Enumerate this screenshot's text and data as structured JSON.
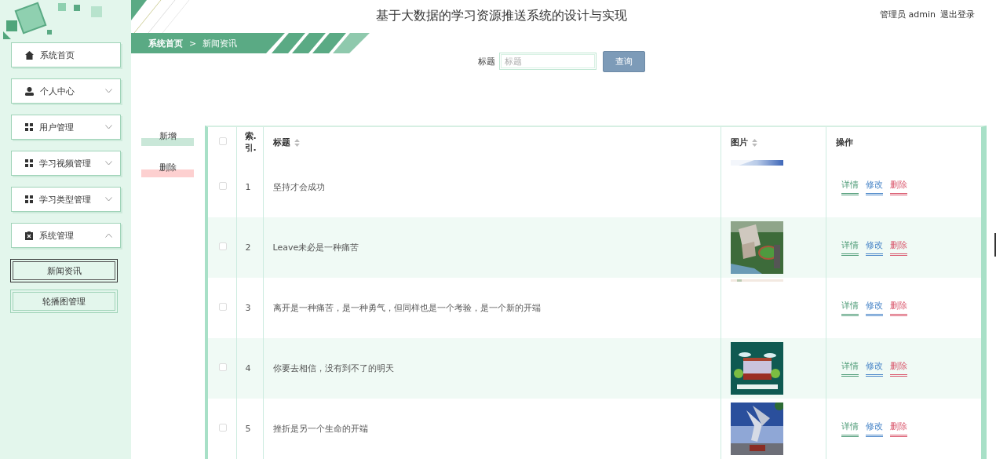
{
  "header": {
    "title": "基于大数据的学习资源推送系统的设计与实现",
    "user_role": "管理员",
    "user_name": "admin",
    "logout": "退出登录"
  },
  "sidebar": {
    "items": [
      {
        "label": "系统首页",
        "kind": "link"
      },
      {
        "label": "个人中心",
        "kind": "group",
        "expanded": false
      },
      {
        "label": "用户管理",
        "kind": "group",
        "expanded": false
      },
      {
        "label": "学习视频管理",
        "kind": "group",
        "expanded": false
      },
      {
        "label": "学习类型管理",
        "kind": "group",
        "expanded": false
      },
      {
        "label": "系统管理",
        "kind": "group",
        "expanded": true,
        "children": [
          {
            "label": "新闻资讯",
            "selected": true
          },
          {
            "label": "轮播图管理",
            "selected": false
          }
        ]
      }
    ]
  },
  "breadcrumb": [
    "系统首页",
    "新闻资讯"
  ],
  "breadcrumb_separator": ">",
  "search": {
    "label": "标题",
    "placeholder": "标题",
    "button": "查询"
  },
  "actions": [
    "新增",
    "删除"
  ],
  "table": {
    "select_all": {
      "checked": false
    },
    "columns": [
      {
        "label": "索.引."
      },
      {
        "label": "标题",
        "sortable": true
      },
      {
        "label": "图片",
        "sortable": true
      },
      {
        "label": "操作"
      }
    ],
    "rows": [
      {
        "selected": false,
        "index": "1",
        "title": "坚持才会成功",
        "actions": [
          {
            "label": "详情",
            "kind": "detail"
          },
          {
            "label": "修改",
            "kind": "edit"
          },
          {
            "label": "删除",
            "kind": "delete"
          }
        ]
      },
      {
        "selected": false,
        "index": "2",
        "title": "Leave未必是一种痛苦",
        "actions": [
          {
            "label": "详情",
            "kind": "detail"
          },
          {
            "label": "修改",
            "kind": "edit"
          },
          {
            "label": "删除",
            "kind": "delete"
          }
        ]
      },
      {
        "selected": false,
        "index": "3",
        "title": "离开是一种痛苦，是一种勇气，但同样也是一个考验，是一个新的开端",
        "actions": [
          {
            "label": "详情",
            "kind": "detail"
          },
          {
            "label": "修改",
            "kind": "edit"
          },
          {
            "label": "删除",
            "kind": "delete"
          }
        ]
      },
      {
        "selected": false,
        "index": "4",
        "title": "你要去相信，没有到不了的明天",
        "actions": [
          {
            "label": "详情",
            "kind": "detail"
          },
          {
            "label": "修改",
            "kind": "edit"
          },
          {
            "label": "删除",
            "kind": "delete"
          }
        ]
      },
      {
        "selected": false,
        "index": "5",
        "title": "挫折是另一个生命的开端",
        "actions": [
          {
            "label": "详情",
            "kind": "detail"
          },
          {
            "label": "修改",
            "kind": "edit"
          },
          {
            "label": "删除",
            "kind": "delete"
          }
        ]
      }
    ]
  }
}
